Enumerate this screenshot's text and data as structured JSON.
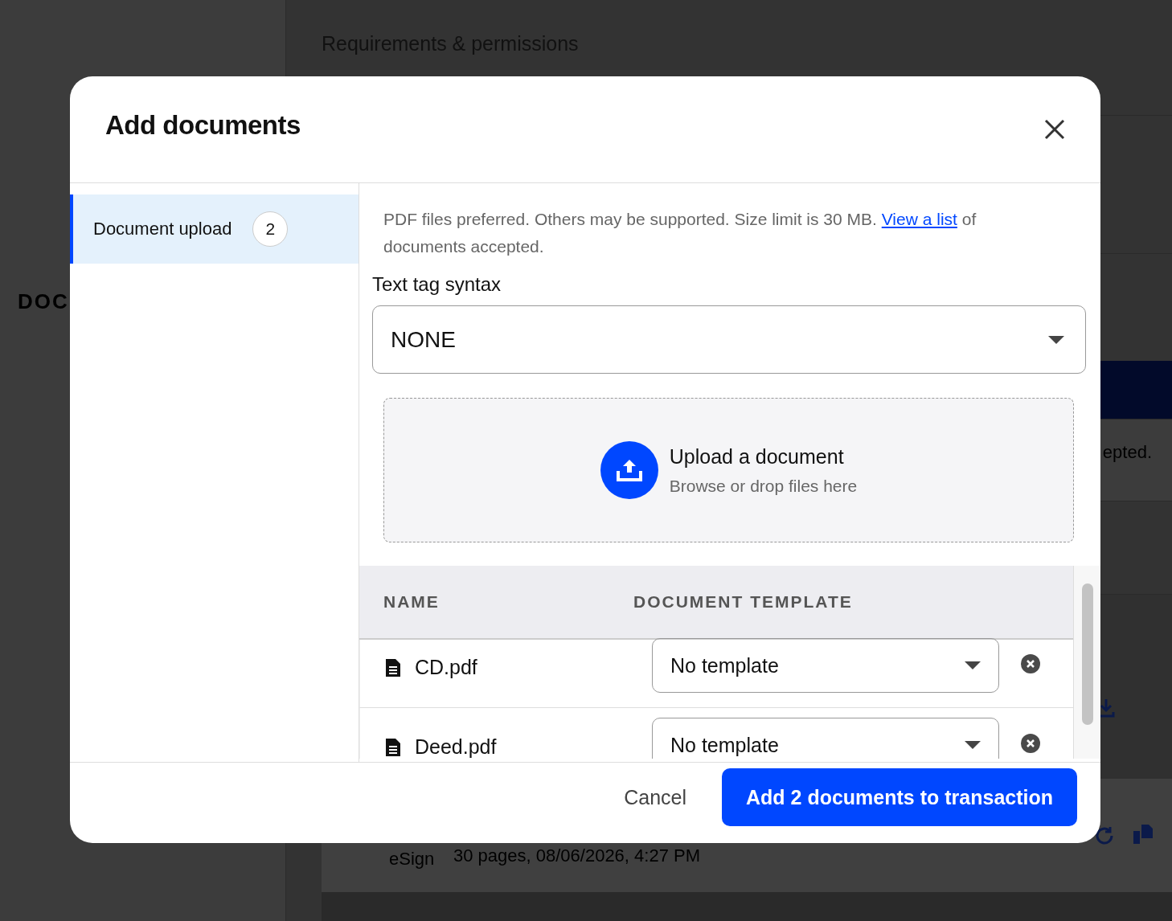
{
  "background": {
    "heading": "Requirements & permissions",
    "section_label": "DOC",
    "fragment": "epted.",
    "doc_source": "eSign",
    "doc_meta": "30 pages, 08/06/2026, 4:27 PM"
  },
  "dialog": {
    "title": "Add documents",
    "sidebar": {
      "items": [
        {
          "label": "Document upload",
          "count": "2",
          "selected": true
        }
      ]
    },
    "description": {
      "before": "PDF files preferred. Others may be supported. Size limit is 30 MB.",
      "link": "View a list",
      "after": "of documents accepted."
    },
    "text_tag_syntax": {
      "label": "Text tag syntax",
      "value": "NONE"
    },
    "upload": {
      "title": "Upload a document",
      "subtitle": "Browse or drop files here"
    },
    "table": {
      "columns": [
        "NAME",
        "DOCUMENT TEMPLATE"
      ],
      "rows": [
        {
          "name": "CD.pdf",
          "template": "No template"
        },
        {
          "name": "Deed.pdf",
          "template": "No template"
        }
      ]
    },
    "buttons": {
      "cancel": "Cancel",
      "submit": "Add 2 documents to transaction"
    }
  }
}
